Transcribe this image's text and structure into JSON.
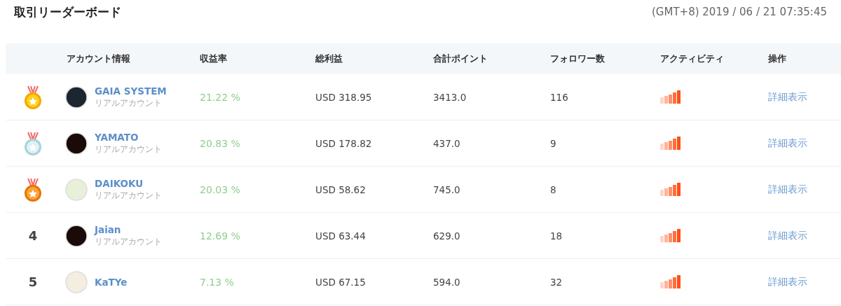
{
  "title": "取引リーダーボード",
  "timestamp": "(GMT+8) 2019 / 06 / 21 07:35:45",
  "table": {
    "columns": [
      "アカウント情報",
      "収益率",
      "総利益",
      "合計ポイント",
      "フォロワー数",
      "アクティビティ",
      "操作"
    ],
    "rows": [
      {
        "rank": {
          "kind": "gold"
        },
        "name": "GAIA SYSTEM",
        "account_type": "リアルアカウント",
        "return": "21.22 %",
        "profit": "USD 318.95",
        "points": "3413.0",
        "followers": "116",
        "action": "詳細表示"
      },
      {
        "rank": {
          "kind": "silver"
        },
        "name": "YAMATO",
        "account_type": "リアルアカウント",
        "return": "20.83 %",
        "profit": "USD 178.82",
        "points": "437.0",
        "followers": "9",
        "action": "詳細表示"
      },
      {
        "rank": {
          "kind": "bronze"
        },
        "name": "DAIKOKU",
        "account_type": "リアルアカウント",
        "return": "20.03 %",
        "profit": "USD 58.62",
        "points": "745.0",
        "followers": "8",
        "action": "詳細表示"
      },
      {
        "rank": {
          "kind": "number",
          "text": "4"
        },
        "name": "Jaian",
        "account_type": "リアルアカウント",
        "return": "12.69 %",
        "profit": "USD 63.44",
        "points": "629.0",
        "followers": "18",
        "action": "詳細表示"
      },
      {
        "rank": {
          "kind": "number",
          "text": "5"
        },
        "name": "KaTYe",
        "return": "7.13 %",
        "profit": "USD 67.15",
        "points": "594.0",
        "followers": "32",
        "action": "詳細表示"
      }
    ]
  }
}
